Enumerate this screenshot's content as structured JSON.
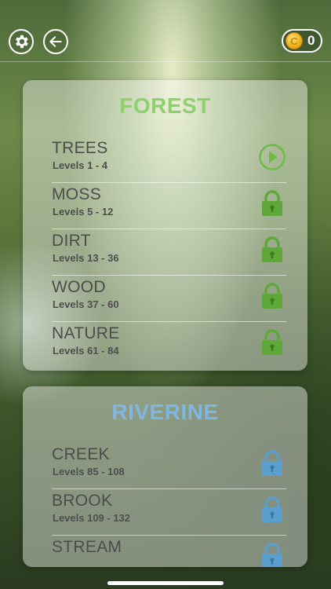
{
  "header": {
    "settings_icon": "gear-icon",
    "back_icon": "back-arrow-icon",
    "coins": "0",
    "coin_symbol": "C"
  },
  "sections": [
    {
      "title": "FOREST",
      "color": "#8fcf6e",
      "levels": [
        {
          "name": "TREES",
          "range": "Levels 1 - 4",
          "state": "play"
        },
        {
          "name": "MOSS",
          "range": "Levels 5 - 12",
          "state": "locked"
        },
        {
          "name": "DIRT",
          "range": "Levels 13 - 36",
          "state": "locked"
        },
        {
          "name": "WOOD",
          "range": "Levels 37 - 60",
          "state": "locked"
        },
        {
          "name": "NATURE",
          "range": "Levels 61 - 84",
          "state": "locked"
        }
      ]
    },
    {
      "title": "RIVERINE",
      "color": "#7fb6e2",
      "levels": [
        {
          "name": "CREEK",
          "range": "Levels 85 - 108",
          "state": "locked"
        },
        {
          "name": "BROOK",
          "range": "Levels 109 - 132",
          "state": "locked"
        },
        {
          "name": "STREAM",
          "range": "",
          "state": "locked"
        }
      ]
    }
  ]
}
